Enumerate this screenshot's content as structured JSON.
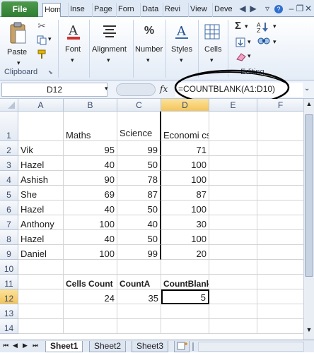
{
  "ribbon_tabs": [
    "Hom",
    "Inse",
    "Page",
    "Forn",
    "Data",
    "Revi",
    "View",
    "Deve"
  ],
  "file_tab": "File",
  "clipboard": {
    "paste_label": "Paste",
    "group_label": "Clipboard"
  },
  "font": {
    "label": "Font"
  },
  "alignment": {
    "label": "Alignment"
  },
  "number": {
    "label": "Number",
    "glyph": "%"
  },
  "styles": {
    "label": "Styles"
  },
  "cells": {
    "label": "Cells"
  },
  "editing": {
    "group_label": "Editing",
    "sum_glyph": "Σ"
  },
  "formula_bar": {
    "name_box": "D12",
    "fx": "fx",
    "formula": "=COUNTBLANK(A1:D10)"
  },
  "grid": {
    "columns": [
      "A",
      "B",
      "C",
      "D",
      "E",
      "F"
    ],
    "rows": [
      {
        "n": "1",
        "cells": [
          "",
          "Maths",
          "Science",
          "Economi cs",
          "",
          ""
        ]
      },
      {
        "n": "2",
        "cells": [
          "Vik",
          "95",
          "99",
          "71",
          "",
          ""
        ]
      },
      {
        "n": "3",
        "cells": [
          "Hazel",
          "40",
          "50",
          "100",
          "",
          ""
        ]
      },
      {
        "n": "4",
        "cells": [
          "Ashish",
          "90",
          "78",
          "100",
          "",
          ""
        ]
      },
      {
        "n": "5",
        "cells": [
          "She",
          "69",
          "87",
          "87",
          "",
          ""
        ]
      },
      {
        "n": "6",
        "cells": [
          "Hazel",
          "40",
          "50",
          "100",
          "",
          ""
        ]
      },
      {
        "n": "7",
        "cells": [
          "Anthony",
          "100",
          "40",
          "30",
          "",
          ""
        ]
      },
      {
        "n": "8",
        "cells": [
          "Hazel",
          "40",
          "50",
          "100",
          "",
          ""
        ]
      },
      {
        "n": "9",
        "cells": [
          "Daniel",
          "100",
          "99",
          "20",
          "",
          ""
        ]
      },
      {
        "n": "10",
        "cells": [
          "",
          "",
          "",
          "",
          "",
          ""
        ]
      },
      {
        "n": "11",
        "cells": [
          "",
          "Cells Count",
          "CountA",
          "CountBlank",
          "",
          ""
        ]
      },
      {
        "n": "12",
        "cells": [
          "",
          "24",
          "35",
          "5",
          "",
          ""
        ]
      },
      {
        "n": "13",
        "cells": [
          "",
          "",
          "",
          "",
          "",
          ""
        ]
      },
      {
        "n": "14",
        "cells": [
          "",
          "",
          "",
          "",
          "",
          ""
        ]
      }
    ]
  },
  "sheets": [
    "Sheet1",
    "Sheet2",
    "Sheet3"
  ],
  "colors": {
    "file_tab": "#2e7d32",
    "selected_header": "#f4c45b",
    "ribbon_bg": "#dfe9f5"
  }
}
